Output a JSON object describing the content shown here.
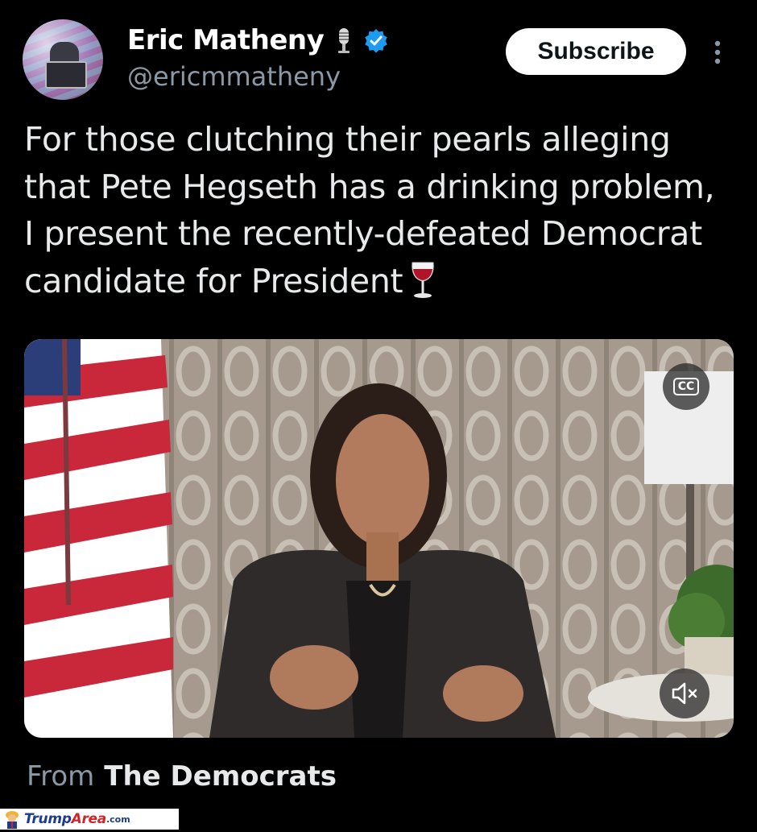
{
  "author": {
    "display_name": "Eric Matheny",
    "handle": "@ericmmatheny",
    "badges": [
      "microphone-icon",
      "verified-badge-icon"
    ]
  },
  "header": {
    "subscribe_label": "Subscribe",
    "more_icon": "more-vertical-icon"
  },
  "tweet": {
    "text": "For those clutching their pearls alleging that Pete Hegseth has a drinking problem, I present the recently-defeated Democrat candidate for President",
    "emoji": "wine-glass-icon"
  },
  "video": {
    "cc_label": "CC",
    "mute_icon": "volume-muted-icon"
  },
  "source": {
    "label": "From",
    "name": "The Democrats"
  },
  "watermark": {
    "brand_part1": "Trump",
    "brand_part2": "Area",
    "suffix": ".com"
  },
  "colors": {
    "background": "#000000",
    "text": "#e7e9ea",
    "muted": "#8b98a5",
    "verified": "#1d9bf0"
  }
}
